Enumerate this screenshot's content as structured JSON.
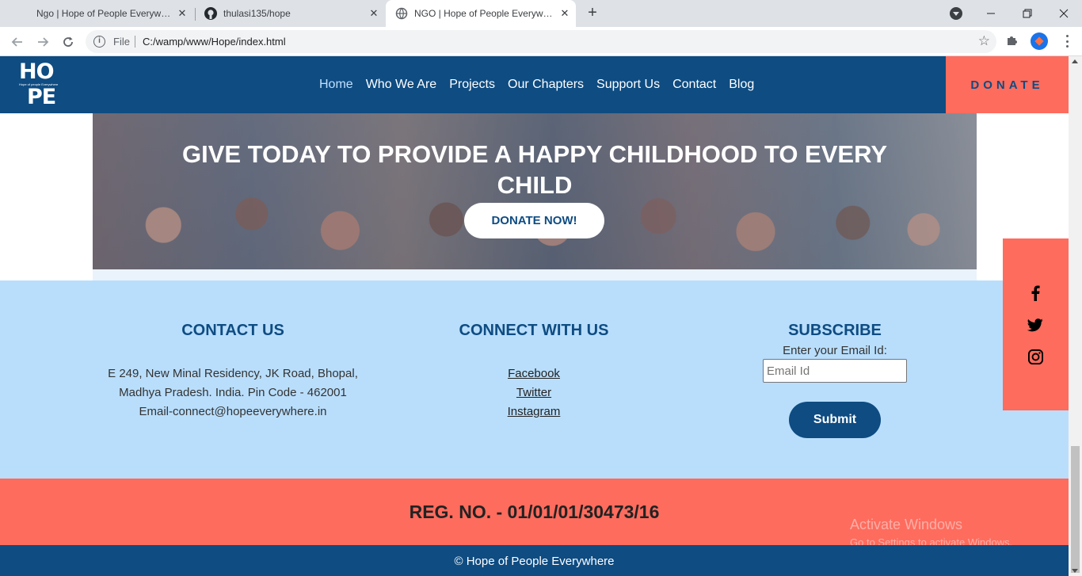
{
  "browser": {
    "tabs": [
      {
        "title": "Ngo | Hope of People Everywhere",
        "active": false
      },
      {
        "title": "thulasi135/hope",
        "active": false
      },
      {
        "title": "NGO | Hope of People Everywhere",
        "active": true
      }
    ],
    "scheme_label": "File",
    "url": "C:/wamp/www/Hope/index.html"
  },
  "header": {
    "logo": {
      "line1": "HO",
      "tagline": "Hope of people Everywhere",
      "line2": "PE"
    },
    "nav": [
      "Home",
      "Who We Are",
      "Projects",
      "Our Chapters",
      "Support Us",
      "Contact",
      "Blog"
    ],
    "active_nav": "Home",
    "donate_label": "DONATE"
  },
  "hero": {
    "headline": "GIVE TODAY TO PROVIDE A HAPPY CHILDHOOD TO EVERY CHILD",
    "cta_label": "DONATE NOW!"
  },
  "footer": {
    "contact": {
      "heading": "CONTACT US",
      "address_line1": "E 249, New Minal Residency, JK Road, Bhopal,",
      "address_line2": "Madhya Pradesh. India. Pin Code - 462001",
      "email_line": "Email-connect@hopeeverywhere.in"
    },
    "connect": {
      "heading": "CONNECT WITH US",
      "links": [
        "Facebook",
        "Twitter",
        "Instagram"
      ]
    },
    "subscribe": {
      "heading": "SUBSCRIBE",
      "label": "Enter your Email Id:",
      "placeholder": "Email Id",
      "value": "",
      "button_label": "Submit"
    },
    "registration": "REG. NO. - 01/01/01/30473/16",
    "copyright": "© Hope of People Everywhere"
  },
  "social_float": [
    "facebook-icon",
    "twitter-icon",
    "instagram-icon"
  ],
  "watermark": {
    "line1": "Activate Windows",
    "line2": "Go to Settings to activate Windows."
  },
  "colors": {
    "brand_blue": "#0e4c82",
    "coral": "#fe6c5e",
    "light_blue": "#b9defc"
  }
}
